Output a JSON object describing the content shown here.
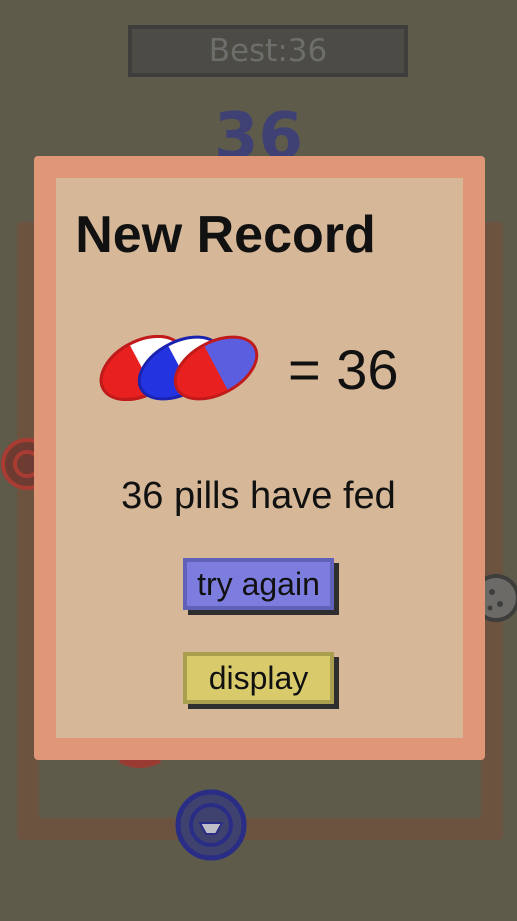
{
  "background": {
    "best_label": "Best:36",
    "score": "36"
  },
  "dialog": {
    "title": "New Record",
    "pill_count_text": "= 36",
    "fed_text": "36 pills have fed",
    "try_again_label": "try again",
    "display_label": "display"
  },
  "colors": {
    "pill_red": "#e8201f",
    "pill_blue": "#2433e0",
    "pill_white": "#ffffff",
    "button_try_again": "#7c7dde",
    "button_display": "#d9cb6c",
    "dialog_frame": "#df9777",
    "dialog_panel": "#d6b898"
  }
}
